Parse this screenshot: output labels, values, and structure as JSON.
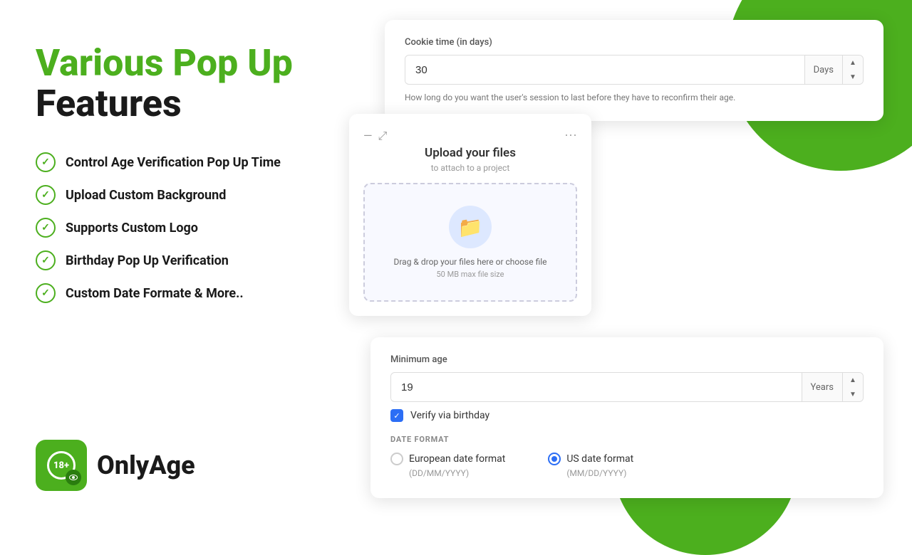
{
  "headline": {
    "line1": "Various Pop Up",
    "line2": "Features"
  },
  "features": [
    "Control Age Verification Pop Up Time",
    "Upload Custom Background",
    "Supports Custom Logo",
    "Birthday Pop Up Verification",
    "Custom Date Formate & More.."
  ],
  "logo": {
    "age_text": "18+",
    "brand_name": "OnlyAge"
  },
  "cookie_card": {
    "label": "Cookie time (in days)",
    "value": "30",
    "suffix": "Days",
    "hint": "How long do you want the user's session to last before they have to reconfirm their age."
  },
  "upload_card": {
    "title": "Upload your files",
    "subtitle": "to attach to a project",
    "drop_text": "Drag & drop your files here or choose file",
    "size_text": "50 MB max file size"
  },
  "minage_card": {
    "label": "Minimum age",
    "value": "19",
    "suffix": "Years",
    "checkbox_label": "Verify via birthday",
    "date_format_title": "DATE FORMAT",
    "option1_label": "European date format",
    "option1_hint": "(DD/MM/YYYY)",
    "option2_label": "US date format",
    "option2_hint": "(MM/DD/YYYY)",
    "option2_selected": true
  },
  "colors": {
    "green": "#4caf1e",
    "blue": "#2c6ef5"
  }
}
